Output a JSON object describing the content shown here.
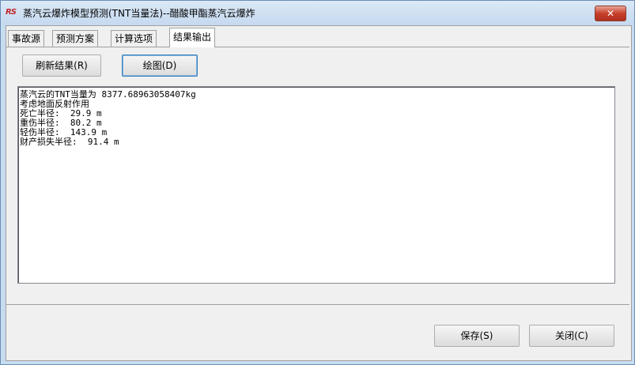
{
  "window": {
    "title": "蒸汽云爆炸模型预测(TNT当量法)--醋酸甲酯蒸汽云爆炸",
    "close_symbol": "✕",
    "app_icon_text": "RS"
  },
  "tabs": [
    {
      "label": "事故源"
    },
    {
      "label": "预测方案"
    },
    {
      "label": "计算选项"
    },
    {
      "label": "结果输出"
    }
  ],
  "toolbar": {
    "refresh_label": "刷新结果(R)",
    "plot_label": "绘图(D)"
  },
  "results": {
    "lines": [
      "蒸汽云的TNT当量为 8377.68963058407kg",
      "考虑地面反射作用",
      "死亡半径:  29.9 m",
      "重伤半径:  80.2 m",
      "轻伤半径:  143.9 m",
      "财产损失半径:  91.4 m"
    ]
  },
  "footer": {
    "save_label": "保存(S)",
    "close_label": "关闭(C)"
  }
}
